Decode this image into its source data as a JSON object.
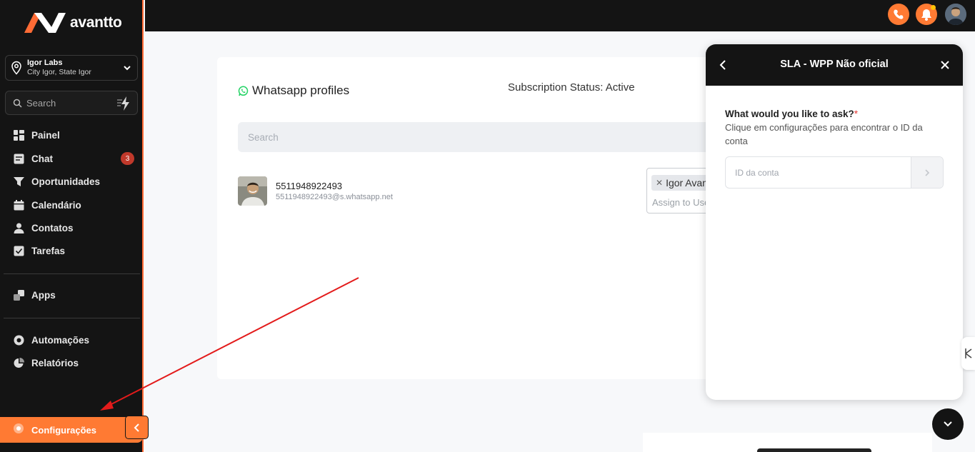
{
  "brand": {
    "name": "avantto"
  },
  "location": {
    "name": "Igor Labs",
    "subtitle": "City Igor, State Igor"
  },
  "sidebar_search": {
    "placeholder": "Search"
  },
  "nav": {
    "painel": "Painel",
    "chat": "Chat",
    "chat_badge": "3",
    "oportunidades": "Oportunidades",
    "calendario": "Calendário",
    "contatos": "Contatos",
    "tarefas": "Tarefas",
    "apps": "Apps",
    "automacoes": "Automações",
    "relatorios": "Relatórios",
    "configuracoes": "Configurações"
  },
  "main": {
    "title": "Whatsapp profiles",
    "subscription_status": "Subscription Status: Active",
    "search_placeholder": "Search",
    "profile": {
      "number": "5511948922493",
      "jid": "5511948922493@s.whatsapp.net",
      "assigned_chip": "Igor Avantto",
      "assign_placeholder": "Assign to User"
    }
  },
  "widget": {
    "title": "SLA - WPP Não oficial",
    "question": "What would you like to ask?",
    "required_mark": "*",
    "description": "Clique em configurações para encontrar o ID da conta",
    "input_placeholder": "ID da conta"
  },
  "colors": {
    "accent": "#ff7a33",
    "dark": "#141414",
    "badge": "#c0392b",
    "whatsapp": "#25d366",
    "annotation": "#e31b1b"
  }
}
